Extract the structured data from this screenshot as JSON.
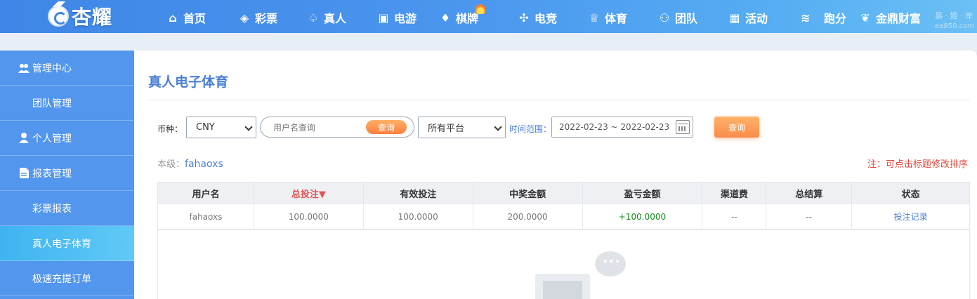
{
  "header": {
    "logo_text": "杏耀",
    "nav": [
      {
        "label": "首页",
        "icon": "home-icon",
        "glyph": "⌂"
      },
      {
        "label": "彩票",
        "icon": "lottery-ticket-icon",
        "glyph": "◈"
      },
      {
        "label": "真人",
        "icon": "live-dealer-icon",
        "glyph": "♤"
      },
      {
        "label": "电游",
        "icon": "slot-machine-icon",
        "glyph": "▣"
      },
      {
        "label": "棋牌",
        "icon": "card-icon",
        "glyph": "♦"
      },
      {
        "label": "电竞",
        "icon": "gamepad-icon",
        "glyph": "✣"
      },
      {
        "label": "体育",
        "icon": "trophy-icon",
        "glyph": "♕"
      },
      {
        "label": "团队",
        "icon": "team-icon",
        "glyph": "⚇"
      },
      {
        "label": "活动",
        "icon": "gift-icon",
        "glyph": "▦"
      },
      {
        "label": "跑分",
        "icon": "running-icon",
        "glyph": "≋"
      },
      {
        "label": "金鼎财富",
        "icon": "wealth-icon",
        "glyph": "❦"
      }
    ],
    "watermark_line1": "暴 · 姬 · 岸",
    "watermark_line2": "ea850.com"
  },
  "sidebar": {
    "items": [
      {
        "label": "管理中心",
        "type": "head",
        "icon": "team-icon"
      },
      {
        "label": "团队管理",
        "type": "sub"
      },
      {
        "label": "个人管理",
        "type": "head",
        "icon": "user-icon"
      },
      {
        "label": "报表管理",
        "type": "head",
        "icon": "document-icon"
      },
      {
        "label": "彩票报表",
        "type": "sub"
      },
      {
        "label": "真人电子体育",
        "type": "sub",
        "active": true
      },
      {
        "label": "极速充提订单",
        "type": "sub"
      }
    ]
  },
  "main": {
    "title": "真人电子体育",
    "filters": {
      "currency_label": "币种：",
      "currency_value": "CNY",
      "username_placeholder": "用户名查询",
      "search_button": "查询",
      "platform_value": "所有平台",
      "time_label": "时间范围：",
      "date_range": "2022-02-23 ~ 2022-02-23",
      "query_button": "查询"
    },
    "level_label": "本级：",
    "level_user": "fahaoxs",
    "note": "注：可点击标题修改排序",
    "table": {
      "headers": [
        "用户名",
        "总投注▼",
        "有效投注",
        "中奖金额",
        "盈亏金额",
        "渠道费",
        "总结算",
        "状态"
      ],
      "row": [
        "fahaoxs",
        "100.0000",
        "100.0000",
        "200.0000",
        "+100.0000",
        "--",
        "--",
        "投注记录"
      ]
    }
  },
  "colors": {
    "header_gradient_start": "#3f86e6",
    "sidebar_bg": "#5296ed",
    "sidebar_active": "#3fb3f1",
    "title_blue": "#4a7fd5",
    "note_red": "#e0483f",
    "button_orange": "#f98b4a",
    "profit_green": "#138a16"
  }
}
